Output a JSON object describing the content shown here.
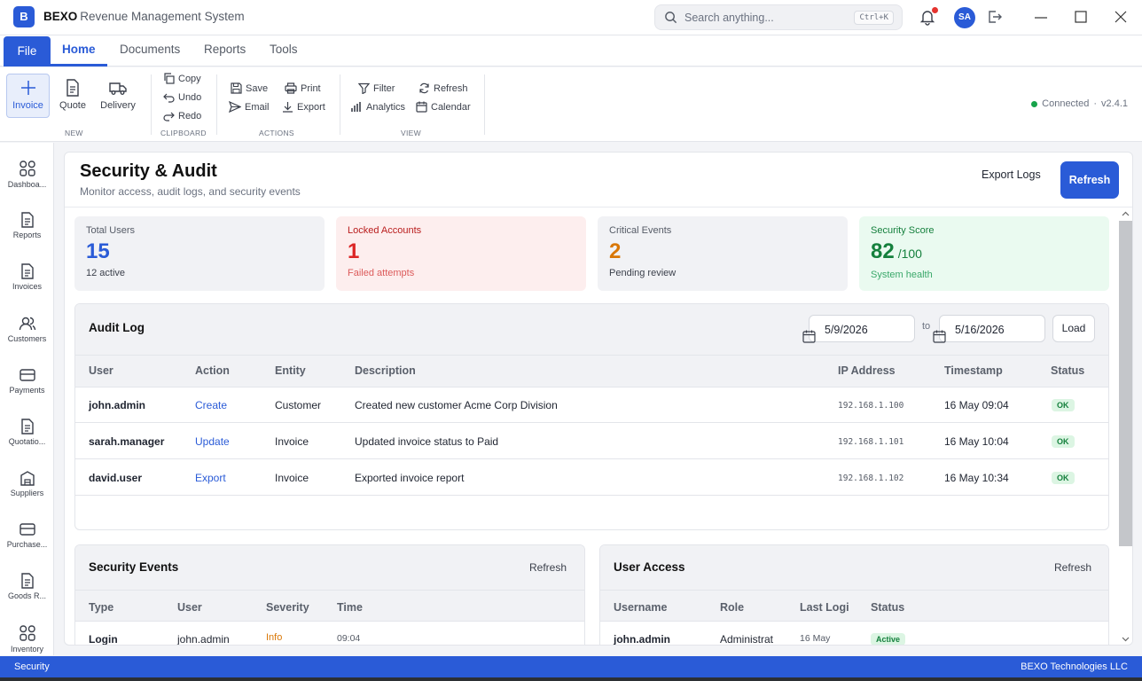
{
  "app": {
    "logo_letter": "B",
    "brand": "BEXO",
    "title": "Revenue Management System"
  },
  "search": {
    "placeholder": "Search anything...",
    "shortcut": "Ctrl+K"
  },
  "user": {
    "initials": "SA"
  },
  "menu": {
    "file": "File",
    "tabs": [
      "Home",
      "Documents",
      "Reports",
      "Tools"
    ],
    "active": "Home"
  },
  "ribbon": {
    "new": {
      "label": "NEW",
      "items": [
        "Invoice",
        "Quote",
        "Delivery"
      ]
    },
    "clipboard": {
      "label": "CLIPBOARD",
      "items": [
        "Copy",
        "Undo",
        "Redo"
      ]
    },
    "actions": {
      "label": "ACTIONS",
      "items": [
        "Save",
        "Print",
        "Email",
        "Export"
      ]
    },
    "view": {
      "label": "VIEW",
      "items": [
        "Filter",
        "Refresh",
        "Analytics",
        "Calendar"
      ]
    },
    "connection": "Connected",
    "version": "v2.4.1"
  },
  "sidebar": {
    "items": [
      "Dashboa...",
      "Reports",
      "Invoices",
      "Customers",
      "Payments",
      "Quotatio...",
      "Suppliers",
      "Purchase...",
      "Goods R...",
      "Inventory"
    ]
  },
  "page": {
    "title": "Security & Audit",
    "subtitle": "Monitor access, audit logs, and security events",
    "export_label": "Export Logs",
    "refresh_label": "Refresh"
  },
  "stats": [
    {
      "label": "Total Users",
      "value": "15",
      "note": "12 active",
      "color": "#2a5bd7"
    },
    {
      "label": "Locked Accounts",
      "value": "1",
      "note": "Failed attempts",
      "color": "#dc2626"
    },
    {
      "label": "Critical Events",
      "value": "2",
      "note": "Pending review",
      "color": "#d97706"
    },
    {
      "label": "Security Score",
      "value": "82",
      "suffix": "/100",
      "note": "System health",
      "color": "#15803d"
    }
  ],
  "audit": {
    "title": "Audit Log",
    "from": "5/9/2026",
    "to_label": "to",
    "to": "5/16/2026",
    "load_label": "Load",
    "columns": [
      "User",
      "Action",
      "Entity",
      "Description",
      "IP Address",
      "Timestamp",
      "Status"
    ],
    "rows": [
      {
        "user": "john.admin",
        "action": "Create",
        "entity": "Customer",
        "description": "Created new customer Acme Corp Division",
        "ip": "192.168.1.100",
        "timestamp": "16 May 09:04",
        "status": "OK"
      },
      {
        "user": "sarah.manager",
        "action": "Update",
        "entity": "Invoice",
        "description": "Updated invoice status to Paid",
        "ip": "192.168.1.101",
        "timestamp": "16 May 10:04",
        "status": "OK"
      },
      {
        "user": "david.user",
        "action": "Export",
        "entity": "Invoice",
        "description": "Exported invoice report",
        "ip": "192.168.1.102",
        "timestamp": "16 May 10:34",
        "status": "OK"
      }
    ]
  },
  "security_events": {
    "title": "Security Events",
    "refresh_label": "Refresh",
    "columns": [
      "Type",
      "User",
      "Severity",
      "Time"
    ],
    "rows": [
      {
        "type": "Login",
        "user": "john.admin",
        "severity": "Info",
        "time": "09:04"
      }
    ]
  },
  "user_access": {
    "title": "User Access",
    "refresh_label": "Refresh",
    "columns": [
      "Username",
      "Role",
      "Last Logi",
      "Status"
    ],
    "rows": [
      {
        "username": "john.admin",
        "role": "Administrat",
        "last_login": "16 May",
        "status": "Active"
      }
    ]
  },
  "statusbar": {
    "left": "Security",
    "right": "BEXO Technologies LLC"
  }
}
